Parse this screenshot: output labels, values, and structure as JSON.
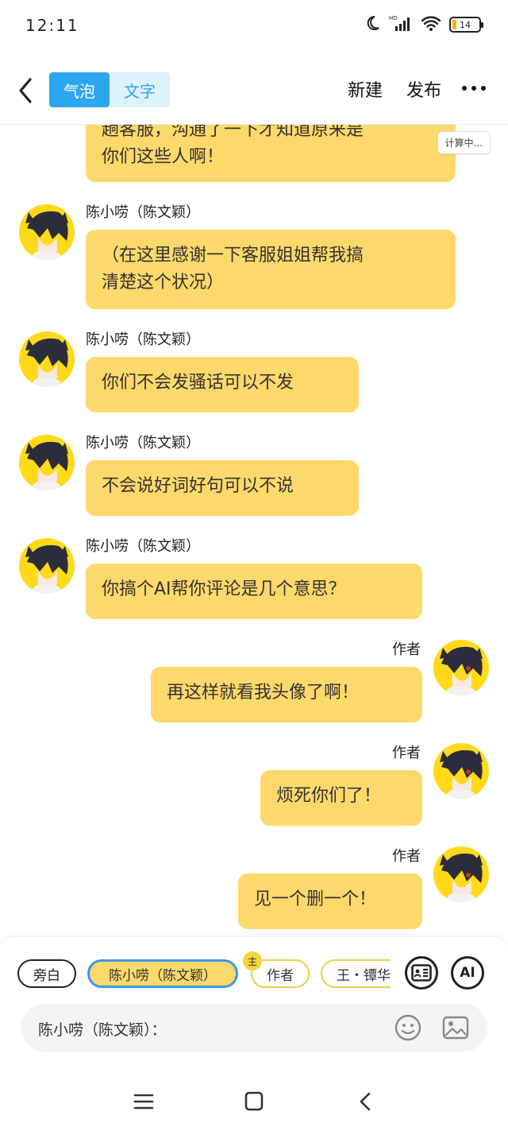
{
  "status_bar": {
    "time": "12:11",
    "battery": "14",
    "network": "HD"
  },
  "header": {
    "tabs": [
      {
        "label": "气泡",
        "active": true
      },
      {
        "label": "文字",
        "active": false
      }
    ],
    "new_label": "新建",
    "publish_label": "发布"
  },
  "chat": {
    "top_partial": {
      "lines": [
        "趟客服，沟通了一下才知道原来是",
        "你们这些人啊！"
      ],
      "badge": "计算中..."
    },
    "messages": [
      {
        "sender": "陈小唠（陈文颖）",
        "side": "left",
        "lines": [
          "（在这里感谢一下客服姐姐帮我搞",
          "清楚这个状况）"
        ]
      },
      {
        "sender": "陈小唠（陈文颖）",
        "side": "left",
        "lines": [
          "你们不会发骚话可以不发"
        ]
      },
      {
        "sender": "陈小唠（陈文颖）",
        "side": "left",
        "lines": [
          "不会说好词好句可以不说"
        ]
      },
      {
        "sender": "陈小唠（陈文颖）",
        "side": "left",
        "lines": [
          "你搞个AI帮你评论是几个意思？"
        ]
      },
      {
        "sender": "作者",
        "side": "right",
        "lines": [
          "再这样就看我头像了啊！"
        ]
      },
      {
        "sender": "作者",
        "side": "right",
        "lines": [
          "烦死你们了！"
        ]
      },
      {
        "sender": "作者",
        "side": "right",
        "lines": [
          "见一个删一个！"
        ]
      }
    ]
  },
  "roles": {
    "narration": "旁白",
    "selected": "陈小唠（陈文颖）",
    "author": "作者",
    "author_badge": "主",
    "wang": "王・镡华"
  },
  "input": {
    "prefix": "陈小唠（陈文颖）："
  },
  "ai_label": "AI",
  "colors": {
    "bubble": "#fdd86b",
    "accent": "#2aa7ef",
    "avatar_bg": "#ffd91a"
  }
}
